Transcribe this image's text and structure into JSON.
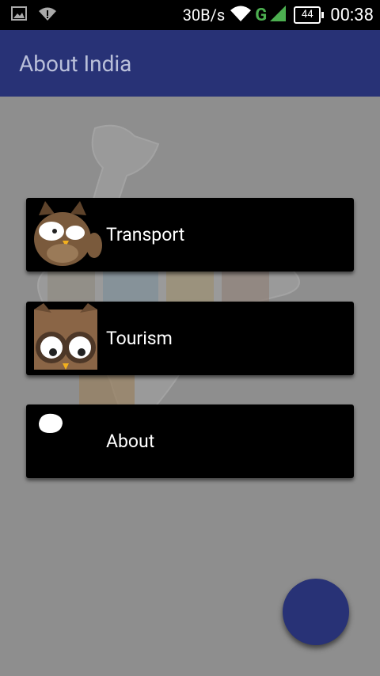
{
  "status_bar": {
    "net_speed": "30B/s",
    "network_type": "G",
    "battery": "44",
    "time": "00:38",
    "icons": [
      "image-icon",
      "signal-alert-icon",
      "wifi-icon",
      "cell-signal-icon",
      "battery-icon"
    ]
  },
  "app_bar": {
    "title": "About India"
  },
  "menu": {
    "items": [
      {
        "label": "Transport",
        "icon": "owl-winking-icon"
      },
      {
        "label": "Tourism",
        "icon": "owl-glasses-icon"
      },
      {
        "label": "About",
        "icon": "white-blob-icon"
      }
    ]
  },
  "fab": {
    "icon": "action-button"
  },
  "colors": {
    "primary": "#283276",
    "card": "#000000",
    "overlay": "#8e8e8e",
    "status_green": "#4caf50"
  }
}
